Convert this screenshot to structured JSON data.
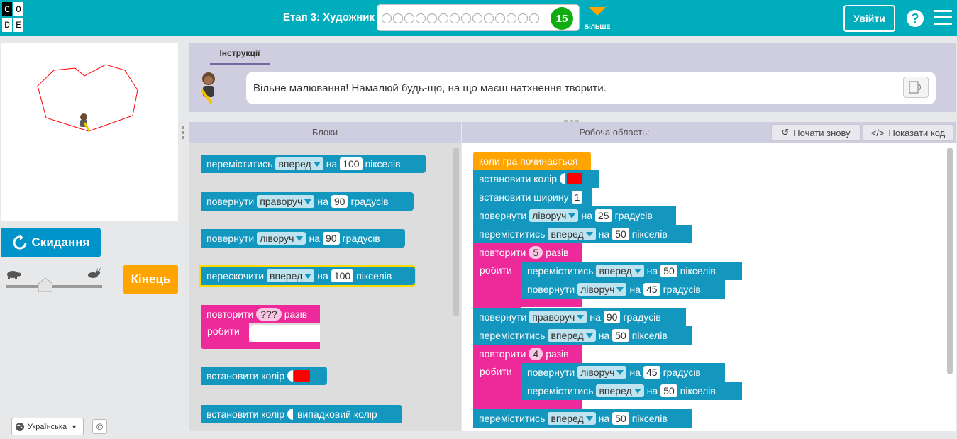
{
  "header": {
    "logo_letters": [
      "C",
      "O",
      "D",
      "E"
    ],
    "stage_title": "Етап 3: Художник",
    "current_level": "15",
    "more_label": "БІЛЬШЕ",
    "signin_label": "Увійти",
    "help_symbol": "?"
  },
  "colors": {
    "header": "#00adbc",
    "blue_block": "#1497bf",
    "pink_block": "#ee2a9b",
    "orange": "#ffa400",
    "pen": "#ff0000"
  },
  "left_panel": {
    "reset_label": "Скидання",
    "finish_label": "Кінець",
    "speed_slow_icon": "turtle-icon",
    "speed_fast_icon": "rabbit-icon",
    "language": "Українська",
    "copyright": "©"
  },
  "instructions": {
    "tab_label": "Інструкції",
    "text": "Вільне малювання! Намалюй будь-що, на що маєш натхнення творити."
  },
  "toolbox": {
    "header": "Блоки",
    "blocks": {
      "move": {
        "a": "переміститись",
        "dir": "вперед",
        "on": "на",
        "val": "100",
        "unit": "пікселів"
      },
      "turn_right": {
        "a": "повернути",
        "dir": "праворуч",
        "on": "на",
        "val": "90",
        "unit": "градусів"
      },
      "turn_left": {
        "a": "повернути",
        "dir": "ліворуч",
        "on": "на",
        "val": "90",
        "unit": "градусів"
      },
      "jump": {
        "a": "перескочити",
        "dir": "вперед",
        "on": "на",
        "val": "100",
        "unit": "пікселів"
      },
      "repeat": {
        "a": "повторити",
        "val": "???",
        "unit": "разів",
        "do": "робити"
      },
      "set_color": {
        "a": "встановити колір"
      },
      "set_random_color": {
        "a": "встановити колір",
        "b": "випадковий колір"
      }
    }
  },
  "workspace": {
    "header": "Робоча область:",
    "restart_label": "Почати знову",
    "show_code_label": "Показати код",
    "event": "коли гра починається",
    "set_color": "встановити колір",
    "set_width": {
      "a": "встановити ширину",
      "val": "1"
    },
    "turn1": {
      "a": "повернути",
      "dir": "ліворуч",
      "on": "на",
      "val": "25",
      "unit": "градусів"
    },
    "move1": {
      "a": "переміститись",
      "dir": "вперед",
      "on": "на",
      "val": "50",
      "unit": "пікселів"
    },
    "repeat1": {
      "a": "повторити",
      "val": "5",
      "unit": "разів",
      "do": "робити"
    },
    "r1_move": {
      "a": "переміститись",
      "dir": "вперед",
      "on": "на",
      "val": "50",
      "unit": "пікселів"
    },
    "r1_turn": {
      "a": "повернути",
      "dir": "ліворуч",
      "on": "на",
      "val": "45",
      "unit": "градусів"
    },
    "turn2": {
      "a": "повернути",
      "dir": "праворуч",
      "on": "на",
      "val": "90",
      "unit": "градусів"
    },
    "move2": {
      "a": "переміститись",
      "dir": "вперед",
      "on": "на",
      "val": "50",
      "unit": "пікселів"
    },
    "repeat2": {
      "a": "повторити",
      "val": "4",
      "unit": "разів",
      "do": "робити"
    },
    "r2_turn": {
      "a": "повернути",
      "dir": "ліворуч",
      "on": "на",
      "val": "45",
      "unit": "градусів"
    },
    "r2_move": {
      "a": "переміститись",
      "dir": "вперед",
      "on": "на",
      "val": "50",
      "unit": "пікселів"
    },
    "move3": {
      "a": "переміститись",
      "dir": "вперед",
      "on": "на",
      "val": "50",
      "unit": "пікселів"
    }
  }
}
